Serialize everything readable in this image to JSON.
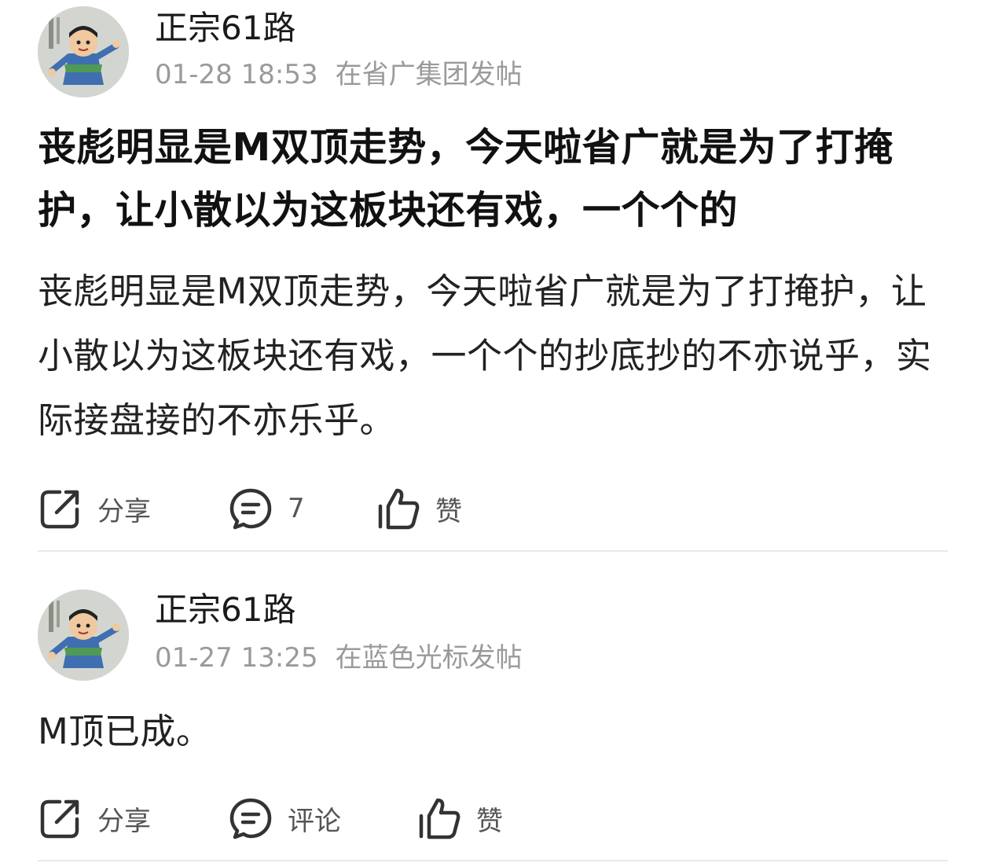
{
  "posts": [
    {
      "author": "正宗61路",
      "time": "01-28 18:53",
      "location": "在省广集团发帖",
      "title": "丧彪明显是M双顶走势，今天啦省广就是为了打掩护，让小散以为这板块还有戏，一个个的",
      "body": "丧彪明显是M双顶走势，今天啦省广就是为了打掩护，让小散以为这板块还有戏，一个个的抄底抄的不亦说乎，实际接盘接的不亦乐乎。",
      "actions": {
        "share": "分享",
        "comment": "7",
        "like": "赞"
      }
    },
    {
      "author": "正宗61路",
      "time": "01-27 13:25",
      "location": "在蓝色光标发帖",
      "body": "M顶已成。",
      "actions": {
        "share": "分享",
        "comment": "评论",
        "like": "赞"
      }
    }
  ],
  "icons": {
    "share": "share-icon",
    "comment": "comment-icon",
    "like": "thumbs-up-icon",
    "avatar": "cartoon-avatar"
  },
  "colors": {
    "text": "#111111",
    "meta": "#9a9a9a",
    "action_label": "#555555",
    "icon_stroke": "#333333",
    "divider": "#e8e8e8"
  }
}
